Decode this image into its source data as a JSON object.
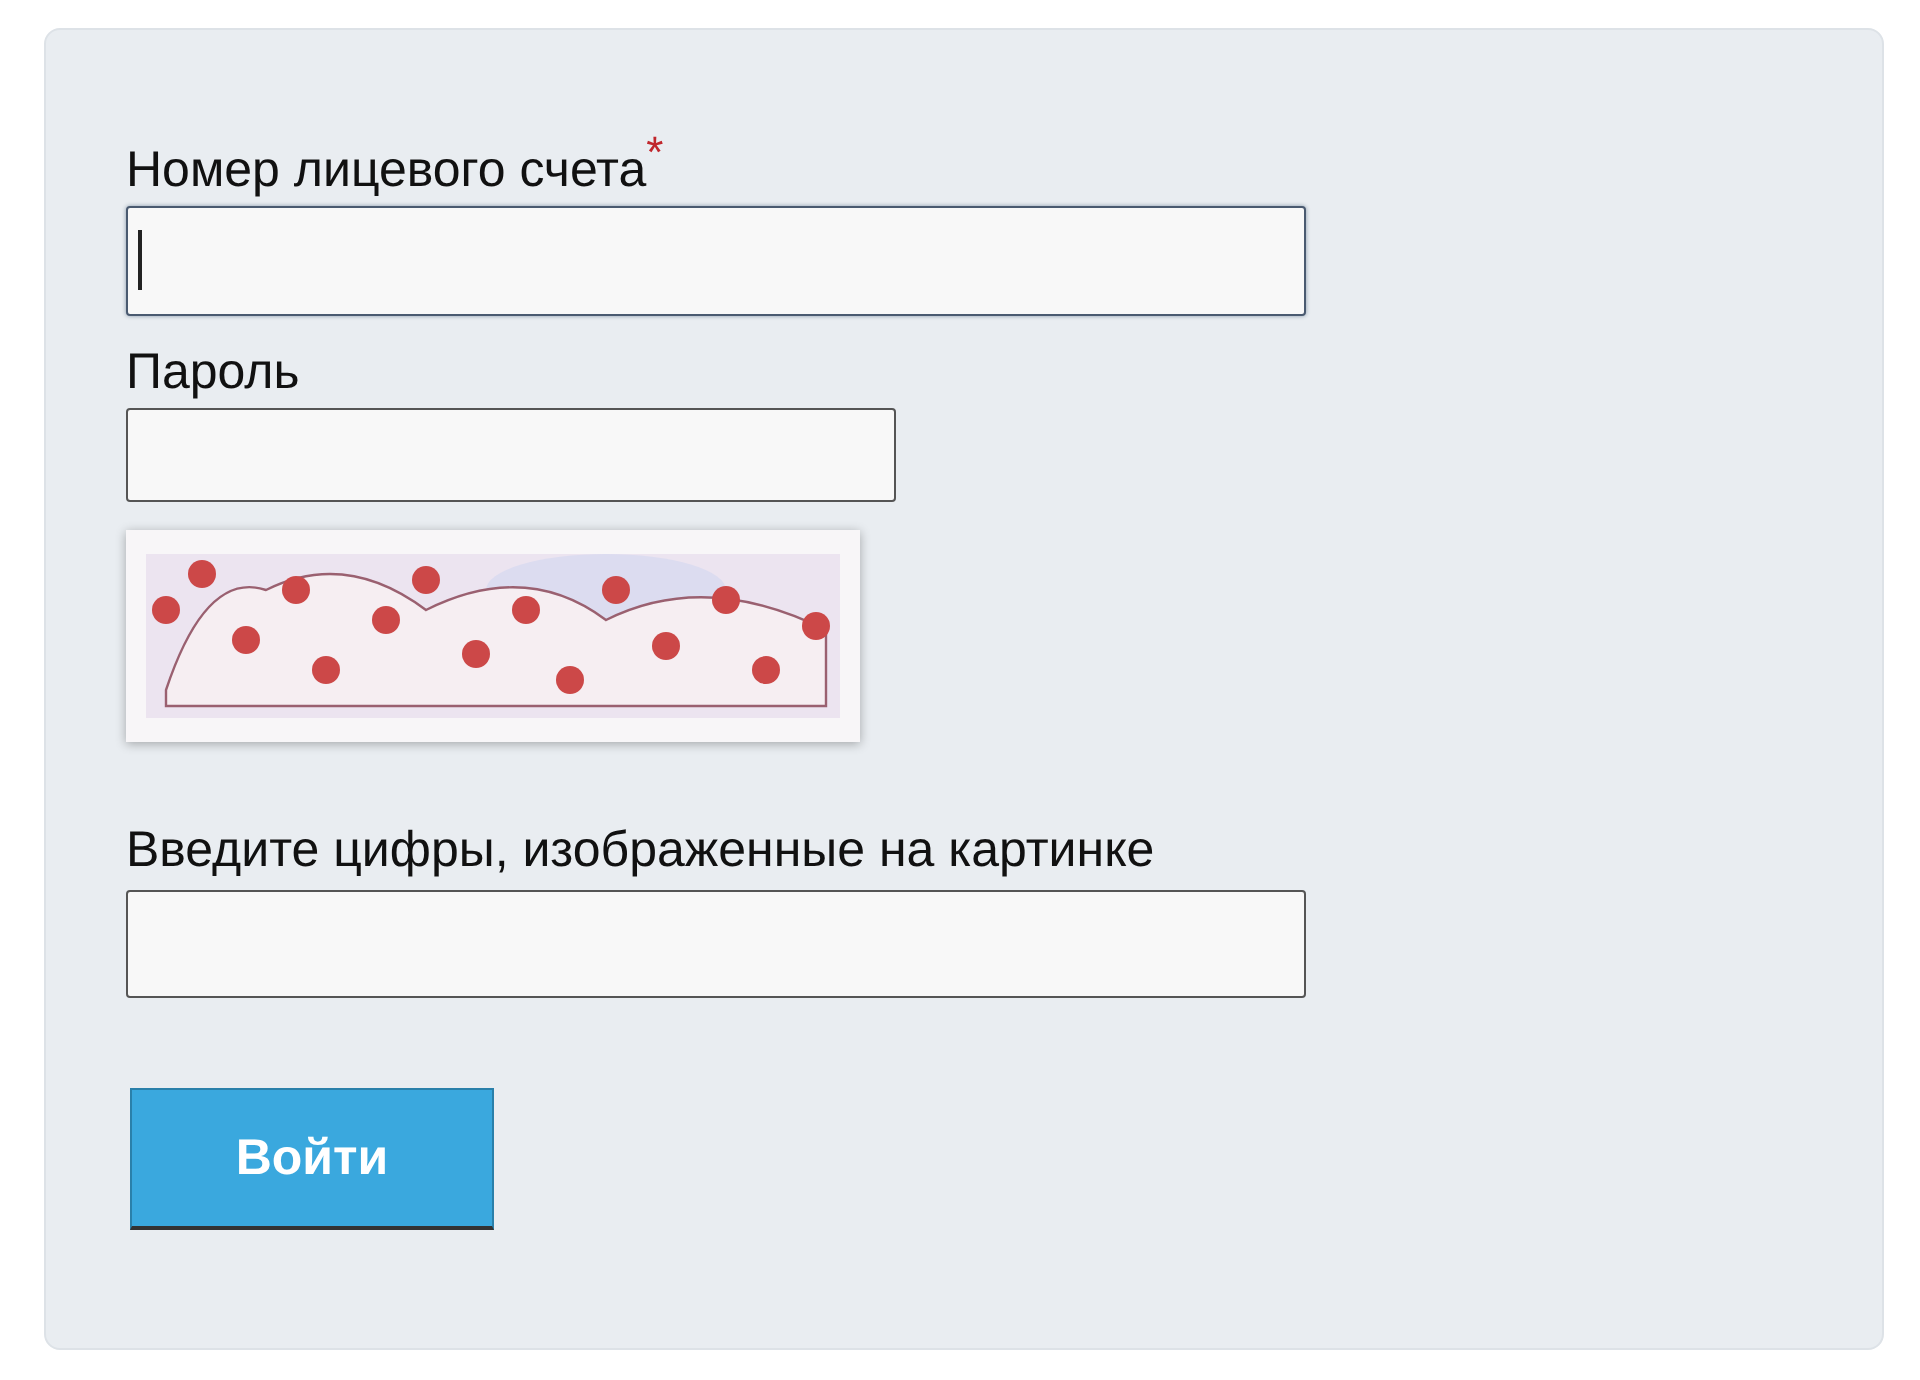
{
  "form": {
    "fields": [
      {
        "label": "Номер лицевого счета",
        "required_mark": "*",
        "focused": true,
        "kind": "text"
      },
      {
        "label": "Пароль",
        "focused": false,
        "kind": "password"
      }
    ],
    "captcha_field": {
      "label": "Введите цифры, изображенные на картинке"
    },
    "submit": "Войти"
  }
}
